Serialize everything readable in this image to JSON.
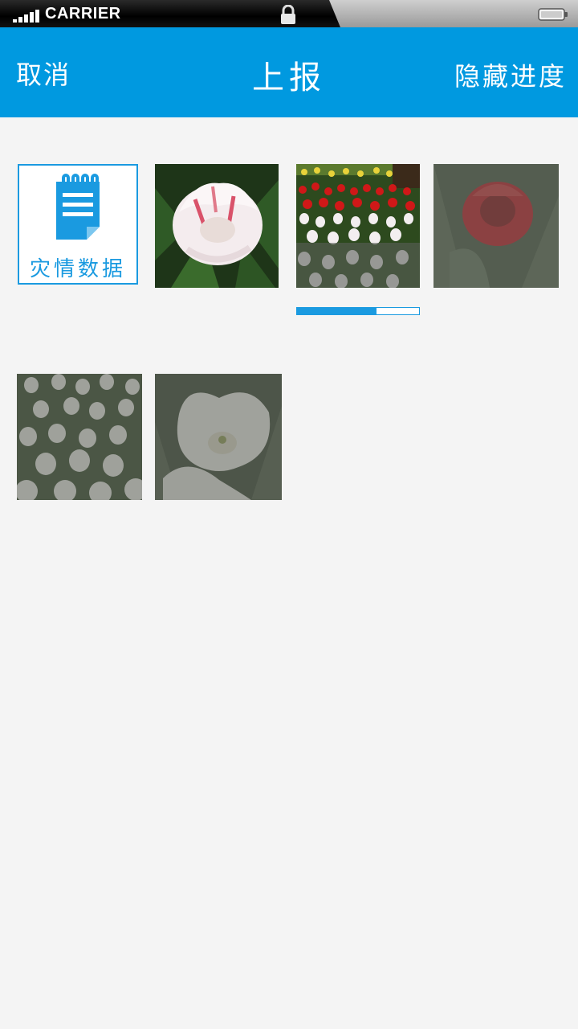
{
  "status_bar": {
    "carrier": "CARRIER",
    "signal_icon": "signal-bars-icon",
    "lock_icon": "lock-icon",
    "battery_icon": "battery-icon"
  },
  "navbar": {
    "left_label": "取消",
    "title": "上报",
    "right_label": "隐藏进度",
    "background": "#0099e0"
  },
  "tiles": {
    "report_tile": {
      "icon": "notepad-icon",
      "label": "灾情数据"
    },
    "photos": [
      {
        "subject": "pink-white tulip",
        "state": "uploaded"
      },
      {
        "subject": "tulip field",
        "state": "uploading",
        "progress": 0.65
      },
      {
        "subject": "red tulip",
        "state": "pending"
      },
      {
        "subject": "white tulips group",
        "state": "pending"
      },
      {
        "subject": "white tulip",
        "state": "pending"
      }
    ]
  },
  "colors": {
    "accent": "#1a9ae0",
    "background": "#f4f4f4"
  }
}
